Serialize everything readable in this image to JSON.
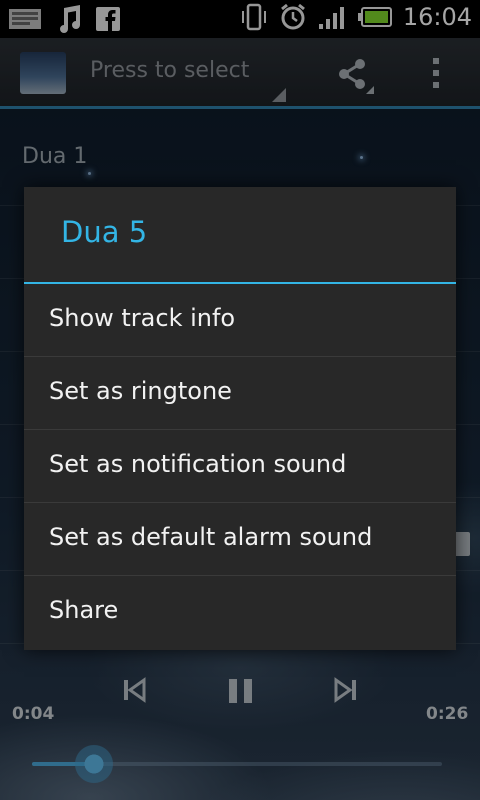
{
  "status_bar": {
    "time": "16:04",
    "left_icons": [
      "image-notification-icon",
      "music-note-icon",
      "facebook-icon"
    ],
    "right_icons": [
      "vibrate-icon",
      "alarm-clock-icon",
      "signal-icon",
      "battery-icon"
    ]
  },
  "action_bar": {
    "spinner_label": "Press to select",
    "icons": [
      "app-icon",
      "share-icon",
      "overflow-menu-icon"
    ]
  },
  "list": {
    "first_item": "Dua 1"
  },
  "dialog": {
    "title": "Dua 5",
    "items": [
      "Show track info",
      "Set as ringtone",
      "Set as notification sound",
      "Set as default alarm sound",
      "Share"
    ]
  },
  "player": {
    "elapsed": "0:04",
    "duration": "0:26",
    "progress_fraction": 0.15,
    "icons": [
      "previous-icon",
      "pause-icon",
      "next-icon"
    ]
  },
  "colors": {
    "accent": "#33b5e5",
    "dialog_bg": "#282828",
    "statusbar_bg": "#000000"
  }
}
